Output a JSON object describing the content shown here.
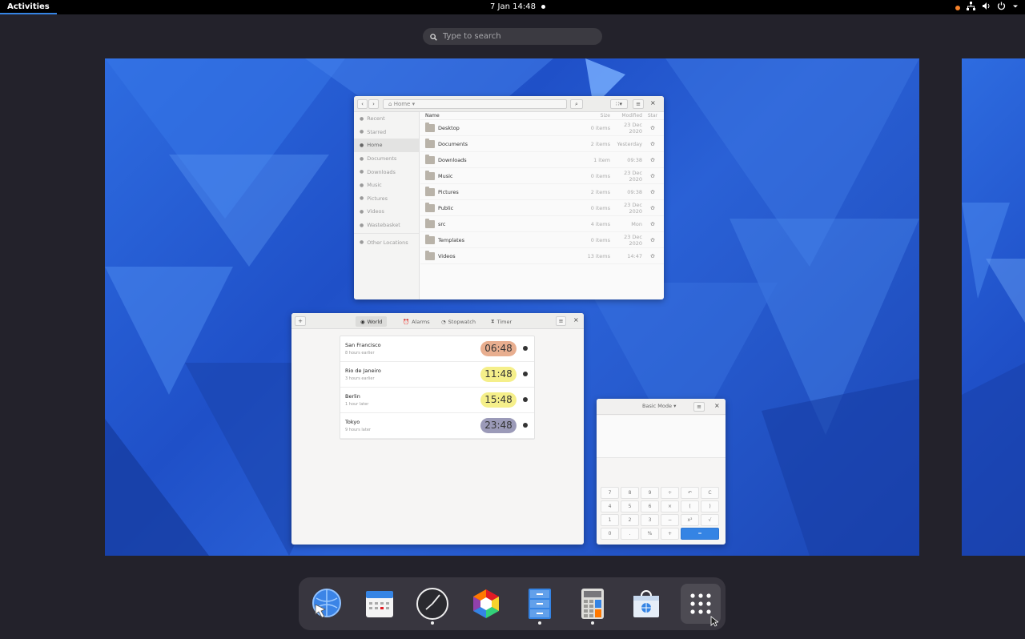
{
  "topbar": {
    "activities": "Activities",
    "clock": "7 Jan  14:48"
  },
  "search": {
    "placeholder": "Type to search"
  },
  "files_window": {
    "location": "Home",
    "sidebar": [
      {
        "label": "Recent",
        "icon": "clock-icon"
      },
      {
        "label": "Starred",
        "icon": "star-icon"
      },
      {
        "label": "Home",
        "icon": "home-icon",
        "active": true
      },
      {
        "label": "Documents",
        "icon": "document-icon"
      },
      {
        "label": "Downloads",
        "icon": "download-icon"
      },
      {
        "label": "Music",
        "icon": "music-icon"
      },
      {
        "label": "Pictures",
        "icon": "picture-icon"
      },
      {
        "label": "Videos",
        "icon": "video-icon"
      },
      {
        "label": "Wastebasket",
        "icon": "trash-icon"
      },
      {
        "label": "Other Locations",
        "icon": "plus-icon"
      }
    ],
    "columns": {
      "name": "Name",
      "size": "Size",
      "modified": "Modified",
      "star": "Star"
    },
    "rows": [
      {
        "name": "Desktop",
        "size": "0 items",
        "modified": "23 Dec 2020"
      },
      {
        "name": "Documents",
        "size": "2 items",
        "modified": "Yesterday"
      },
      {
        "name": "Downloads",
        "size": "1 item",
        "modified": "09:38"
      },
      {
        "name": "Music",
        "size": "0 items",
        "modified": "23 Dec 2020"
      },
      {
        "name": "Pictures",
        "size": "2 items",
        "modified": "09:38"
      },
      {
        "name": "Public",
        "size": "0 items",
        "modified": "23 Dec 2020"
      },
      {
        "name": "src",
        "size": "4 items",
        "modified": "Mon"
      },
      {
        "name": "Templates",
        "size": "0 items",
        "modified": "23 Dec 2020"
      },
      {
        "name": "Videos",
        "size": "13 items",
        "modified": "14:47"
      }
    ]
  },
  "clocks_window": {
    "add_label": "+",
    "tabs": [
      {
        "label": "World",
        "icon": "globe-icon",
        "active": true
      },
      {
        "label": "Alarms",
        "icon": "alarm-icon"
      },
      {
        "label": "Stopwatch",
        "icon": "stopwatch-icon"
      },
      {
        "label": "Timer",
        "icon": "hourglass-icon"
      }
    ],
    "cities": [
      {
        "city": "San Francisco",
        "offset": "8 hours earlier",
        "time": "06:48",
        "color": "#e8ae8f"
      },
      {
        "city": "Rio de Janeiro",
        "offset": "3 hours earlier",
        "time": "11:48",
        "color": "#f5ef8a"
      },
      {
        "city": "Berlin",
        "offset": "1 hour later",
        "time": "15:48",
        "color": "#f5ef8a"
      },
      {
        "city": "Tokyo",
        "offset": "9 hours later",
        "time": "23:48",
        "color": "#9b9ab8"
      }
    ]
  },
  "calculator_window": {
    "mode": "Basic Mode",
    "keys": [
      "7",
      "8",
      "9",
      "÷",
      "↶",
      "C",
      "4",
      "5",
      "6",
      "×",
      "(",
      ")",
      "1",
      "2",
      "3",
      "−",
      "x²",
      "√",
      "0",
      ".",
      "%",
      "+",
      "="
    ]
  },
  "dock": [
    {
      "name": "web-browser",
      "icon": "globe-cursor-icon",
      "running": false
    },
    {
      "name": "calendar",
      "icon": "calendar-icon",
      "running": false
    },
    {
      "name": "clocks",
      "icon": "clock-icon",
      "running": true
    },
    {
      "name": "software",
      "icon": "color-hexagon-icon",
      "running": false
    },
    {
      "name": "files",
      "icon": "file-cabinet-icon",
      "running": true
    },
    {
      "name": "calculator",
      "icon": "calculator-icon",
      "running": true
    },
    {
      "name": "store",
      "icon": "shopping-bag-icon",
      "running": false
    },
    {
      "name": "show-apps",
      "icon": "app-grid-icon",
      "running": false
    }
  ],
  "colors": {
    "accent": "#3584e4",
    "panel": "#000000",
    "overview_bg": "#23222b"
  }
}
